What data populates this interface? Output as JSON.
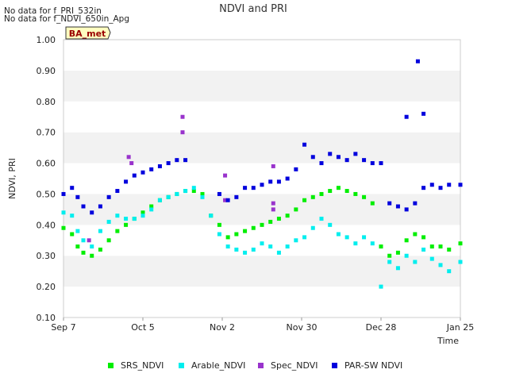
{
  "notes": [
    "No data for f_PRI_532in",
    "No data for f_NDVI_650in_Apg"
  ],
  "badge": "BA_met",
  "chart_data": {
    "type": "scatter",
    "title": "NDVI and PRI",
    "xlabel": "Time",
    "ylabel": "NDVI, PRI",
    "ylim": [
      0.1,
      1.0
    ],
    "x_ticks": [
      "Sep 7",
      "Oct 5",
      "Nov 2",
      "Nov 30",
      "Dec 28",
      "Jan 25"
    ],
    "y_ticks": [
      "0.10",
      "0.20",
      "0.30",
      "0.40",
      "0.50",
      "0.60",
      "0.70",
      "0.80",
      "0.90",
      "1.00"
    ],
    "xlim": [
      "Sep 7",
      "Jan 25"
    ],
    "grid": "alternating horizontal bands",
    "legend_position": "bottom",
    "series": [
      {
        "name": "SRS_NDVI",
        "color": "#00ee00",
        "points": [
          [
            "Sep 7",
            0.39
          ],
          [
            "Sep 10",
            0.37
          ],
          [
            "Sep 12",
            0.33
          ],
          [
            "Sep 14",
            0.31
          ],
          [
            "Sep 17",
            0.3
          ],
          [
            "Sep 20",
            0.32
          ],
          [
            "Sep 23",
            0.35
          ],
          [
            "Sep 26",
            0.38
          ],
          [
            "Sep 29",
            0.4
          ],
          [
            "Oct 2",
            0.42
          ],
          [
            "Oct 5",
            0.44
          ],
          [
            "Oct 8",
            0.46
          ],
          [
            "Oct 11",
            0.48
          ],
          [
            "Oct 14",
            0.49
          ],
          [
            "Oct 17",
            0.5
          ],
          [
            "Oct 20",
            0.51
          ],
          [
            "Oct 23",
            0.51
          ],
          [
            "Oct 26",
            0.5
          ],
          [
            "Oct 29",
            0.43
          ],
          [
            "Nov 1",
            0.4
          ],
          [
            "Nov 4",
            0.36
          ],
          [
            "Nov 7",
            0.37
          ],
          [
            "Nov 10",
            0.38
          ],
          [
            "Nov 13",
            0.39
          ],
          [
            "Nov 16",
            0.4
          ],
          [
            "Nov 19",
            0.41
          ],
          [
            "Nov 22",
            0.42
          ],
          [
            "Nov 25",
            0.43
          ],
          [
            "Nov 28",
            0.45
          ],
          [
            "Dec 1",
            0.48
          ],
          [
            "Dec 4",
            0.49
          ],
          [
            "Dec 7",
            0.5
          ],
          [
            "Dec 10",
            0.51
          ],
          [
            "Dec 13",
            0.52
          ],
          [
            "Dec 16",
            0.51
          ],
          [
            "Dec 19",
            0.5
          ],
          [
            "Dec 22",
            0.49
          ],
          [
            "Dec 25",
            0.47
          ],
          [
            "Dec 28",
            0.33
          ],
          [
            "Dec 31",
            0.3
          ],
          [
            "Jan 3",
            0.31
          ],
          [
            "Jan 6",
            0.35
          ],
          [
            "Jan 9",
            0.37
          ],
          [
            "Jan 12",
            0.36
          ],
          [
            "Jan 15",
            0.33
          ],
          [
            "Jan 18",
            0.33
          ],
          [
            "Jan 21",
            0.32
          ],
          [
            "Jan 25",
            0.34
          ]
        ]
      },
      {
        "name": "Arable_NDVI",
        "color": "#00eeee",
        "points": [
          [
            "Sep 7",
            0.44
          ],
          [
            "Sep 10",
            0.43
          ],
          [
            "Sep 12",
            0.38
          ],
          [
            "Sep 14",
            0.35
          ],
          [
            "Sep 17",
            0.33
          ],
          [
            "Sep 20",
            0.38
          ],
          [
            "Sep 23",
            0.41
          ],
          [
            "Sep 26",
            0.43
          ],
          [
            "Sep 29",
            0.42
          ],
          [
            "Oct 2",
            0.42
          ],
          [
            "Oct 5",
            0.43
          ],
          [
            "Oct 8",
            0.45
          ],
          [
            "Oct 11",
            0.48
          ],
          [
            "Oct 14",
            0.49
          ],
          [
            "Oct 17",
            0.5
          ],
          [
            "Oct 20",
            0.51
          ],
          [
            "Oct 23",
            0.52
          ],
          [
            "Oct 26",
            0.49
          ],
          [
            "Oct 29",
            0.43
          ],
          [
            "Nov 1",
            0.37
          ],
          [
            "Nov 4",
            0.33
          ],
          [
            "Nov 7",
            0.32
          ],
          [
            "Nov 10",
            0.31
          ],
          [
            "Nov 13",
            0.32
          ],
          [
            "Nov 16",
            0.34
          ],
          [
            "Nov 19",
            0.33
          ],
          [
            "Nov 22",
            0.31
          ],
          [
            "Nov 25",
            0.33
          ],
          [
            "Nov 28",
            0.35
          ],
          [
            "Dec 1",
            0.36
          ],
          [
            "Dec 4",
            0.39
          ],
          [
            "Dec 7",
            0.42
          ],
          [
            "Dec 10",
            0.4
          ],
          [
            "Dec 13",
            0.37
          ],
          [
            "Dec 16",
            0.36
          ],
          [
            "Dec 19",
            0.34
          ],
          [
            "Dec 22",
            0.36
          ],
          [
            "Dec 25",
            0.34
          ],
          [
            "Dec 28",
            0.2
          ],
          [
            "Dec 31",
            0.28
          ],
          [
            "Jan 3",
            0.26
          ],
          [
            "Jan 6",
            0.3
          ],
          [
            "Jan 9",
            0.28
          ],
          [
            "Jan 12",
            0.32
          ],
          [
            "Jan 15",
            0.29
          ],
          [
            "Jan 18",
            0.27
          ],
          [
            "Jan 21",
            0.25
          ],
          [
            "Jan 25",
            0.28
          ]
        ]
      },
      {
        "name": "Spec_NDVI",
        "color": "#9933cc",
        "points": [
          [
            "Sep 16",
            0.35
          ],
          [
            "Sep 30",
            0.62
          ],
          [
            "Oct 1",
            0.6
          ],
          [
            "Oct 19",
            0.75
          ],
          [
            "Oct 19",
            0.7
          ],
          [
            "Nov 3",
            0.56
          ],
          [
            "Nov 3",
            0.48
          ],
          [
            "Nov 20",
            0.59
          ],
          [
            "Nov 20",
            0.47
          ],
          [
            "Nov 20",
            0.45
          ]
        ]
      },
      {
        "name": "PAR-SW NDVI",
        "color": "#0000dd",
        "points": [
          [
            "Sep 7",
            0.5
          ],
          [
            "Sep 10",
            0.52
          ],
          [
            "Sep 12",
            0.49
          ],
          [
            "Sep 14",
            0.46
          ],
          [
            "Sep 17",
            0.44
          ],
          [
            "Sep 20",
            0.46
          ],
          [
            "Sep 23",
            0.49
          ],
          [
            "Sep 26",
            0.51
          ],
          [
            "Sep 29",
            0.54
          ],
          [
            "Oct 2",
            0.56
          ],
          [
            "Oct 5",
            0.57
          ],
          [
            "Oct 8",
            0.58
          ],
          [
            "Oct 11",
            0.59
          ],
          [
            "Oct 14",
            0.6
          ],
          [
            "Oct 17",
            0.61
          ],
          [
            "Oct 20",
            0.61
          ],
          [
            "Nov 1",
            0.5
          ],
          [
            "Nov 4",
            0.48
          ],
          [
            "Nov 7",
            0.49
          ],
          [
            "Nov 10",
            0.52
          ],
          [
            "Nov 13",
            0.52
          ],
          [
            "Nov 16",
            0.53
          ],
          [
            "Nov 19",
            0.54
          ],
          [
            "Nov 22",
            0.54
          ],
          [
            "Nov 25",
            0.55
          ],
          [
            "Nov 28",
            0.58
          ],
          [
            "Dec 1",
            0.66
          ],
          [
            "Dec 4",
            0.62
          ],
          [
            "Dec 7",
            0.6
          ],
          [
            "Dec 10",
            0.63
          ],
          [
            "Dec 13",
            0.62
          ],
          [
            "Dec 16",
            0.61
          ],
          [
            "Dec 19",
            0.63
          ],
          [
            "Dec 22",
            0.61
          ],
          [
            "Dec 25",
            0.6
          ],
          [
            "Dec 28",
            0.6
          ],
          [
            "Dec 31",
            0.47
          ],
          [
            "Jan 3",
            0.46
          ],
          [
            "Jan 6",
            0.45
          ],
          [
            "Jan 9",
            0.47
          ],
          [
            "Jan 12",
            0.52
          ],
          [
            "Jan 15",
            0.53
          ],
          [
            "Jan 18",
            0.52
          ],
          [
            "Jan 21",
            0.53
          ],
          [
            "Jan 25",
            0.53
          ],
          [
            "Jan 10",
            0.93
          ],
          [
            "Jan 6",
            0.75
          ],
          [
            "Jan 12",
            0.76
          ]
        ]
      }
    ]
  }
}
